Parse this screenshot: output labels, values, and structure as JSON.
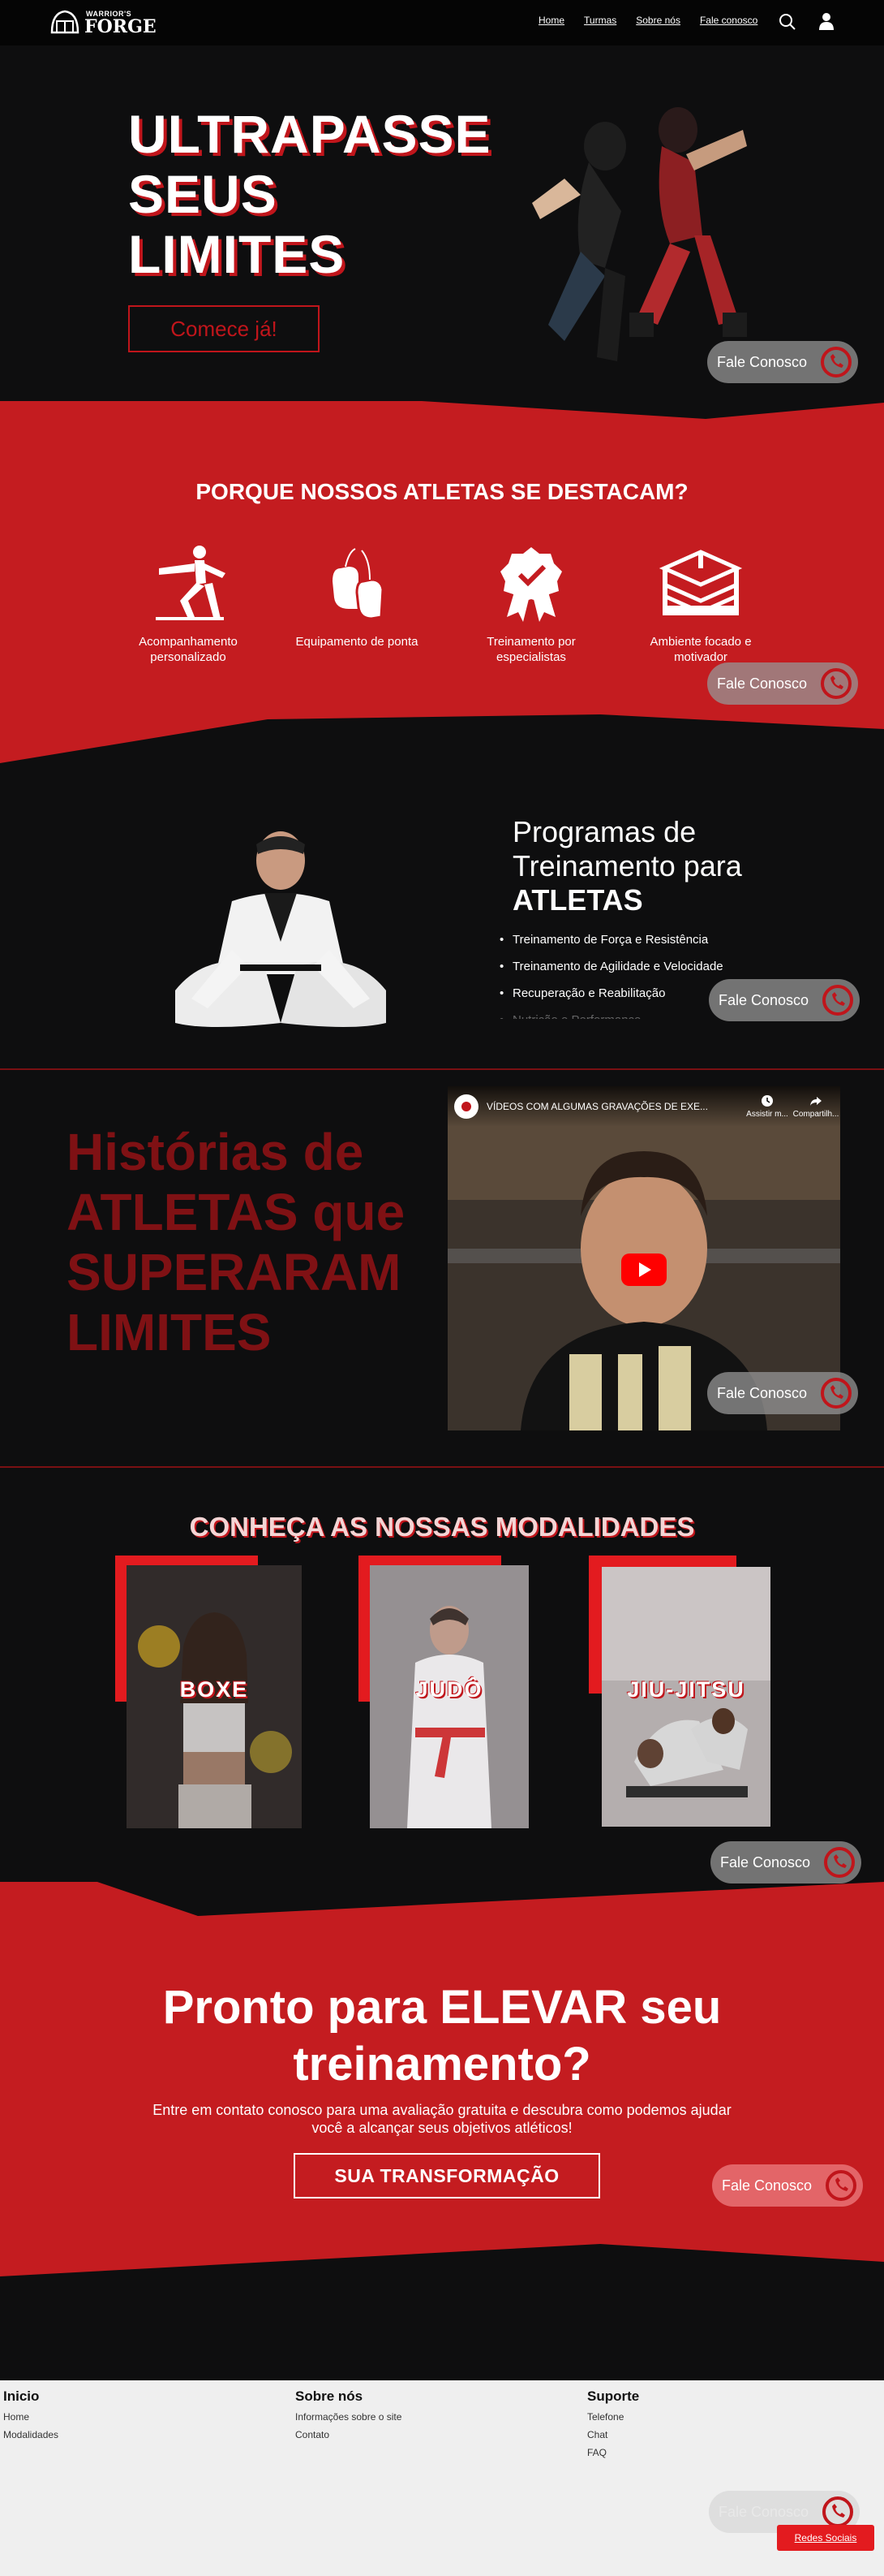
{
  "nav": {
    "logo_line1": "WARRIOR'S",
    "logo_line2": "FORGE",
    "links": [
      "Home",
      "Turmas",
      "Sobre nós",
      "Fale conosco"
    ]
  },
  "hero": {
    "title_l1": "ULTRAPASSE",
    "title_l2": "SEUS",
    "title_l3": "LIMITES",
    "cta": "Comece já!"
  },
  "whatsapp_label": "Fale Conosco",
  "features": {
    "title": "PORQUE NOSSOS ATLETAS SE DESTACAM?",
    "items": [
      {
        "label": "Acompanhamento personalizado",
        "icon": "martial-arts-kick-icon"
      },
      {
        "label": "Equipamento de ponta",
        "icon": "boxing-gloves-icon"
      },
      {
        "label": "Treinamento por especialistas",
        "icon": "award-badge-icon"
      },
      {
        "label": "Ambiente focado e motivador",
        "icon": "boxing-ring-icon"
      }
    ]
  },
  "programs": {
    "title_l1": "Programas de",
    "title_l2": "Treinamento para",
    "title_bold": "ATLETAS",
    "items": [
      "Treinamento de Força e Resistência",
      "Treinamento de Agilidade e Velocidade",
      "Recuperação e Reabilitação",
      "Nutrição e Performance"
    ]
  },
  "stories": {
    "title": "Histórias de ATLETAS que SUPERARAM LIMITES",
    "video_title": "VÍDEOS COM ALGUMAS GRAVAÇÕES DE EXE...",
    "video_watch": "Assistir m...",
    "video_share": "Compartilh..."
  },
  "modalities": {
    "title": "CONHEÇA AS NOSSAS MODALIDADES",
    "items": [
      "BOXE",
      "JUDÔ",
      "JIU-JITSU"
    ]
  },
  "cta": {
    "title_l1": "Pronto para ELEVAR seu",
    "title_l2": "treinamento?",
    "subtitle": "Entre em contato conosco para uma avaliação gratuita e descubra como podemos ajudar você a alcançar seus objetivos atléticos!",
    "button": "SUA TRANSFORMAÇÃO"
  },
  "footer": {
    "col1": {
      "title": "Inicio",
      "links": [
        "Home",
        "Modalidades"
      ]
    },
    "col2": {
      "title": "Sobre nós",
      "links": [
        "Informações sobre o site",
        "Contato"
      ]
    },
    "col3": {
      "title": "Suporte",
      "links": [
        "Telefone",
        "Chat",
        "FAQ"
      ]
    },
    "social_button": "Redes Sociais"
  },
  "colors": {
    "accent": "#c0151b",
    "bright_red": "#e31b1f",
    "bg": "#0e0e0f"
  }
}
